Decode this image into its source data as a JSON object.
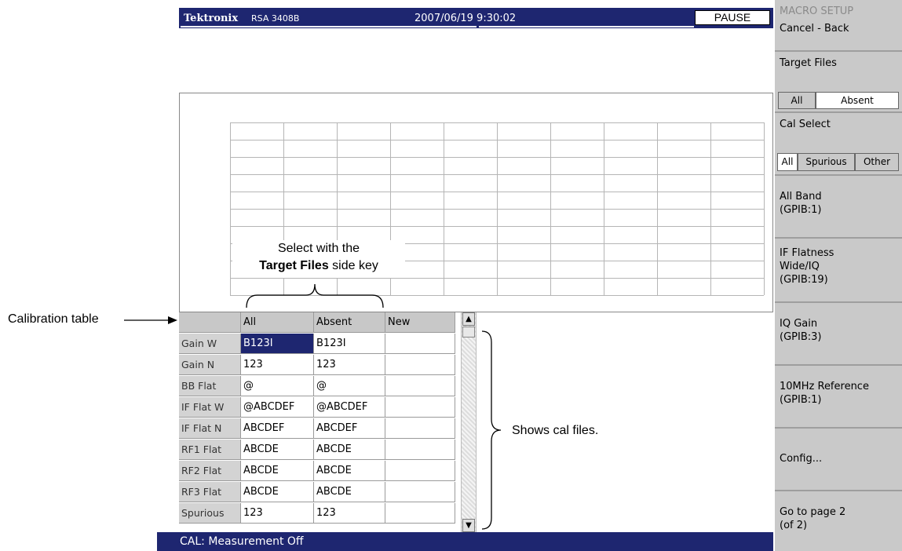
{
  "title_bar": {
    "brand": "Tektronix",
    "model": "RSA 3408B",
    "datetime": "2007/06/19 9:30:02",
    "pause_label": "PAUSE"
  },
  "annotations": {
    "select_line1": "Select with the",
    "select_bold": "Target Files",
    "select_rest": " side key",
    "calibration_table": "Calibration table",
    "shows_cal_files": "Shows cal files."
  },
  "table": {
    "columns": [
      "",
      "All",
      "Absent",
      "New"
    ],
    "rows": [
      {
        "label": "Gain W",
        "all": "B123I",
        "absent": "B123I",
        "new": ""
      },
      {
        "label": "Gain N",
        "all": "123",
        "absent": "123",
        "new": ""
      },
      {
        "label": "BB Flat",
        "all": "@",
        "absent": "@",
        "new": ""
      },
      {
        "label": "IF Flat W",
        "all": "@ABCDEF",
        "absent": "@ABCDEF",
        "new": ""
      },
      {
        "label": "IF Flat N",
        "all": "ABCDEF",
        "absent": "ABCDEF",
        "new": ""
      },
      {
        "label": "RF1 Flat",
        "all": "ABCDE",
        "absent": "ABCDE",
        "new": ""
      },
      {
        "label": "RF2 Flat",
        "all": "ABCDE",
        "absent": "ABCDE",
        "new": ""
      },
      {
        "label": "RF3 Flat",
        "all": "ABCDE",
        "absent": "ABCDE",
        "new": ""
      },
      {
        "label": "Spurious",
        "all": "123",
        "absent": "123",
        "new": ""
      }
    ],
    "selected_cell": "Gain W / All"
  },
  "scrollbar": {
    "up_icon": "▲",
    "down_icon": "▼"
  },
  "status_bar": {
    "text": "CAL: Measurement Off"
  },
  "side_menu": {
    "title": "MACRO SETUP",
    "cancel": "Cancel - Back",
    "target_files": {
      "label": "Target Files",
      "options": [
        "All",
        "Absent"
      ],
      "selected": "Absent"
    },
    "cal_select": {
      "label": "Cal Select",
      "options": [
        "All",
        "Spurious",
        "Other"
      ],
      "selected": "All"
    },
    "items": [
      "All Band\n(GPIB:1)",
      "IF Flatness\nWide/IQ\n(GPIB:19)",
      "IQ Gain\n(GPIB:3)",
      "10MHz Reference\n(GPIB:1)",
      "Config...",
      "Go to page 2\n(of 2)"
    ]
  },
  "colors": {
    "title_bar": "#1e2670",
    "selection": "#1e2670",
    "side_menu": "#c9c9c9",
    "grid": "#b5b5b5"
  }
}
